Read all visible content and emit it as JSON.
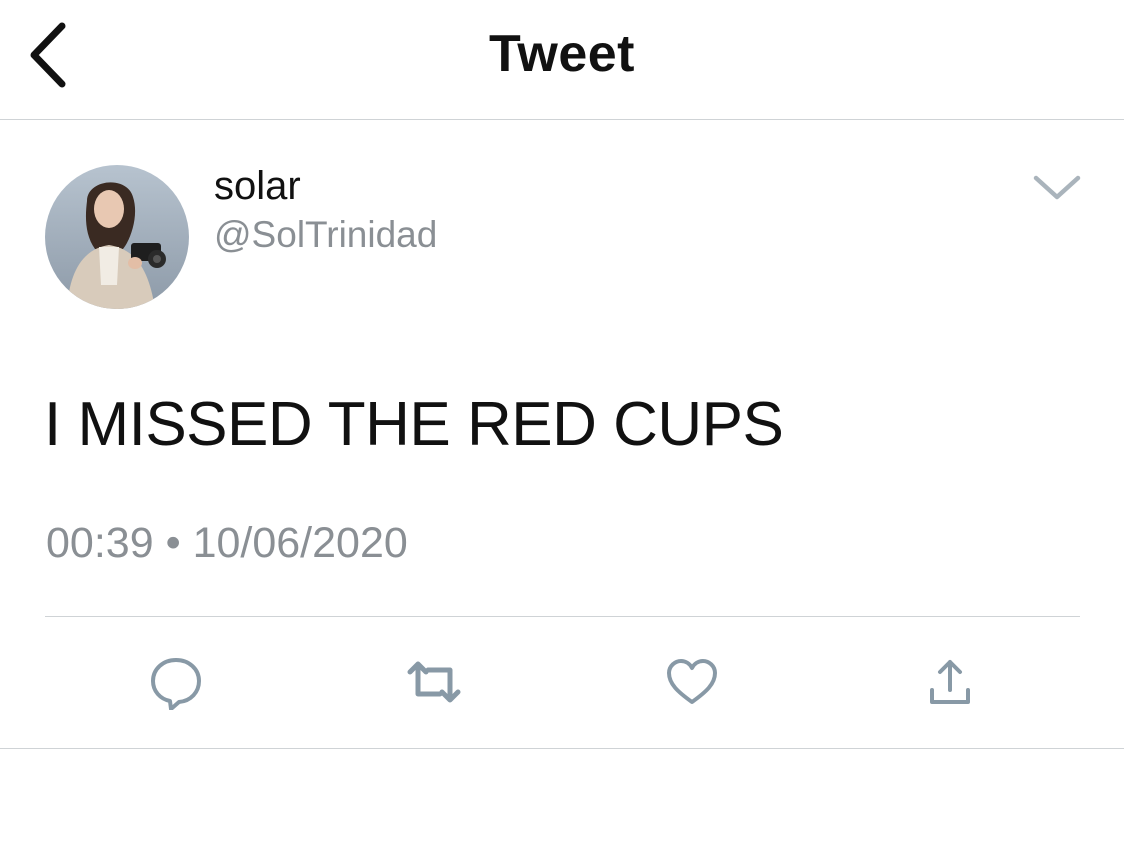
{
  "header": {
    "title": "Tweet",
    "back_icon": "chevron-left-icon"
  },
  "author": {
    "display_name": "solar",
    "handle": "@SolTrinidad",
    "avatar": "profile photo"
  },
  "tweet": {
    "text": "I MISSED THE RED CUPS",
    "time": "00:39",
    "separator": "•",
    "date": "10/06/2020"
  },
  "actions": [
    {
      "name": "reply",
      "icon": "reply-bubble-icon"
    },
    {
      "name": "retweet",
      "icon": "retweet-icon"
    },
    {
      "name": "like",
      "icon": "heart-icon"
    },
    {
      "name": "share",
      "icon": "share-upload-icon"
    }
  ],
  "colors": {
    "text": "#111111",
    "secondary": "#8a8f94",
    "icon": "#8899a6",
    "divider": "#cfd3d6",
    "background": "#ffffff"
  }
}
